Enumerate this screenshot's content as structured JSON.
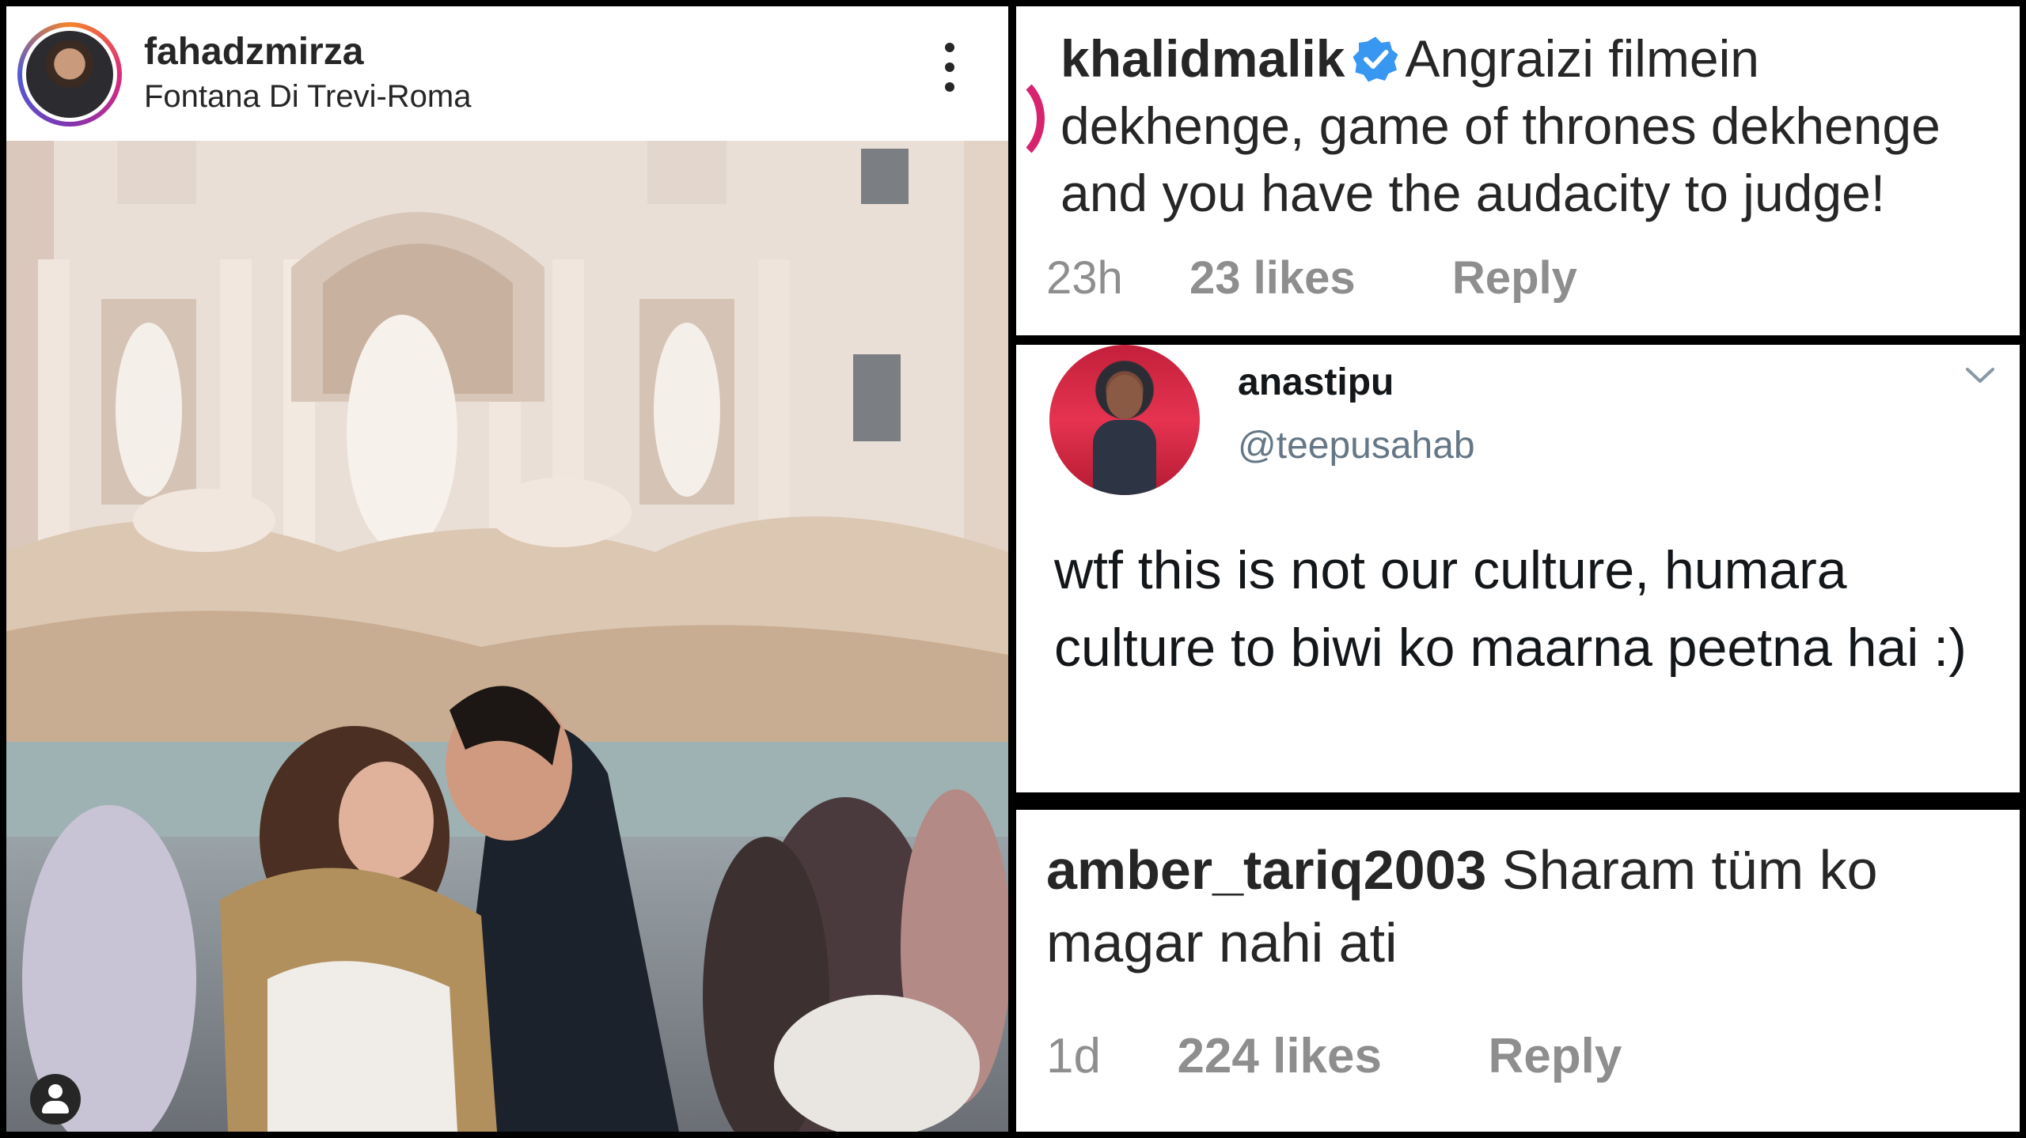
{
  "post": {
    "username": "fahadzmirza",
    "location": "Fontana Di Trevi-Roma",
    "more_icon": "more-vertical-icon",
    "user_tag_icon": "user-icon"
  },
  "comments": [
    {
      "username": "khalidmalik",
      "verified": true,
      "text": "Angraizi filmein dekhenge, game of thrones dekhenge and you have the audacity to judge!",
      "time": "23h",
      "likes": "23 likes",
      "reply": "Reply"
    },
    {
      "name": "anastipu",
      "handle": "@teepusahab",
      "text": "wtf this is not our culture, humara culture to biwi ko maarna peetna hai :)",
      "menu_icon": "chevron-down-icon"
    },
    {
      "username": "amber_tariq2003",
      "text": "Sharam tüm ko magar nahi ati",
      "time": "1d",
      "likes": "224 likes",
      "reply": "Reply"
    }
  ],
  "colors": {
    "text": "#262626",
    "meta": "#8e8e8e",
    "verified": "#3897f0",
    "twitter_handle": "#657786"
  }
}
